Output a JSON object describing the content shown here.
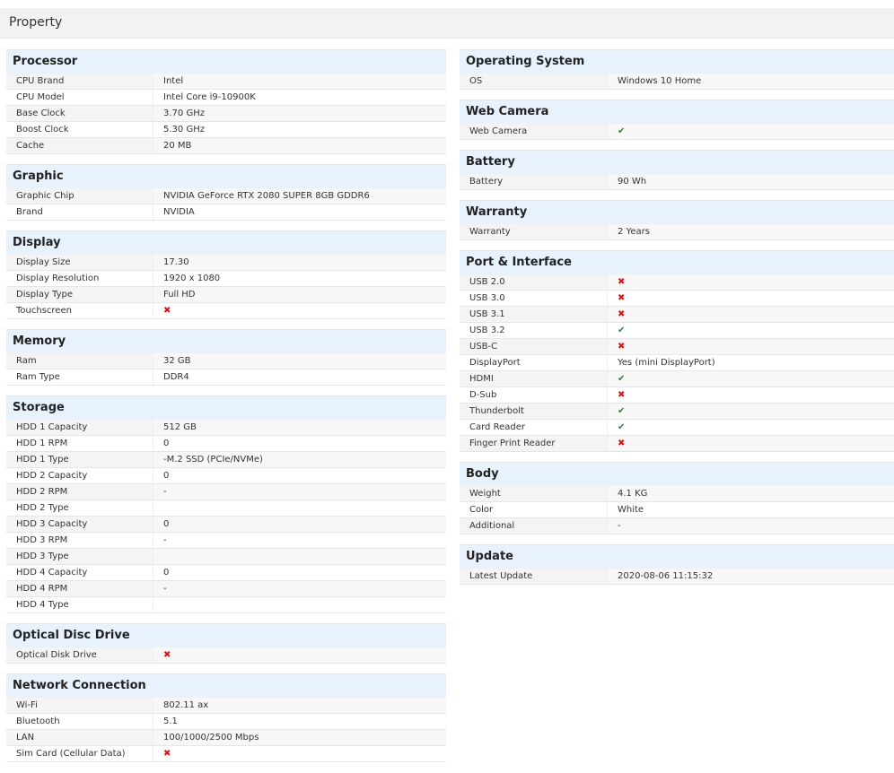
{
  "page_title": "Property",
  "colors": {
    "check": "#2e8a2e",
    "cross": "#d0191b",
    "section_bg": "#e8f2fd"
  },
  "left": [
    {
      "title": "Processor",
      "rows": [
        {
          "k": "CPU Brand",
          "v": "Intel"
        },
        {
          "k": "CPU Model",
          "v": "Intel Core i9-10900K"
        },
        {
          "k": "Base Clock",
          "v": "3.70 GHz"
        },
        {
          "k": "Boost Clock",
          "v": "5.30 GHz"
        },
        {
          "k": "Cache",
          "v": "20 MB"
        }
      ]
    },
    {
      "title": "Graphic",
      "rows": [
        {
          "k": "Graphic Chip",
          "v": "NVIDIA GeForce RTX 2080 SUPER 8GB GDDR6"
        },
        {
          "k": "Brand",
          "v": "NVIDIA"
        }
      ]
    },
    {
      "title": "Display",
      "rows": [
        {
          "k": "Display Size",
          "v": "17.30"
        },
        {
          "k": "Display Resolution",
          "v": "1920 x 1080"
        },
        {
          "k": "Display Type",
          "v": "Full HD"
        },
        {
          "k": "Touchscreen",
          "v": "",
          "icon": "cross-icon"
        }
      ]
    },
    {
      "title": "Memory",
      "rows": [
        {
          "k": "Ram",
          "v": "32 GB"
        },
        {
          "k": "Ram Type",
          "v": "DDR4"
        }
      ]
    },
    {
      "title": "Storage",
      "rows": [
        {
          "k": "HDD 1 Capacity",
          "v": "512 GB"
        },
        {
          "k": "HDD 1 RPM",
          "v": "0"
        },
        {
          "k": "HDD 1 Type",
          "v": "-M.2 SSD (PCIe/NVMe)"
        },
        {
          "k": "HDD 2 Capacity",
          "v": "0"
        },
        {
          "k": "HDD 2 RPM",
          "v": "-"
        },
        {
          "k": "HDD 2 Type",
          "v": ""
        },
        {
          "k": "HDD 3 Capacity",
          "v": "0"
        },
        {
          "k": "HDD 3 RPM",
          "v": "-"
        },
        {
          "k": "HDD 3 Type",
          "v": ""
        },
        {
          "k": "HDD 4 Capacity",
          "v": "0"
        },
        {
          "k": "HDD 4 RPM",
          "v": "-"
        },
        {
          "k": "HDD 4 Type",
          "v": ""
        }
      ]
    },
    {
      "title": "Optical Disc Drive",
      "rows": [
        {
          "k": "Optical Disk Drive",
          "v": "",
          "icon": "cross-icon"
        }
      ]
    },
    {
      "title": "Network Connection",
      "rows": [
        {
          "k": "Wi-Fi",
          "v": "802.11 ax"
        },
        {
          "k": "Bluetooth",
          "v": "5.1"
        },
        {
          "k": "LAN",
          "v": "100/1000/2500 Mbps"
        },
        {
          "k": "Sim Card (Cellular Data)",
          "v": "",
          "icon": "cross-icon"
        }
      ]
    }
  ],
  "right": [
    {
      "title": "Operating System",
      "rows": [
        {
          "k": "OS",
          "v": "Windows 10 Home"
        }
      ]
    },
    {
      "title": "Web Camera",
      "rows": [
        {
          "k": "Web Camera",
          "v": "",
          "icon": "check-icon"
        }
      ]
    },
    {
      "title": "Battery",
      "rows": [
        {
          "k": "Battery",
          "v": "90 Wh"
        }
      ]
    },
    {
      "title": "Warranty",
      "rows": [
        {
          "k": "Warranty",
          "v": "2 Years"
        }
      ]
    },
    {
      "title": "Port & Interface",
      "rows": [
        {
          "k": "USB 2.0",
          "v": "",
          "icon": "cross-icon"
        },
        {
          "k": "USB 3.0",
          "v": "",
          "icon": "cross-icon"
        },
        {
          "k": "USB 3.1",
          "v": "",
          "icon": "cross-icon"
        },
        {
          "k": "USB 3.2",
          "v": "",
          "icon": "check-icon"
        },
        {
          "k": "USB-C",
          "v": "",
          "icon": "cross-icon"
        },
        {
          "k": "DisplayPort",
          "v": "Yes (mini DisplayPort)"
        },
        {
          "k": "HDMI",
          "v": "",
          "icon": "check-icon"
        },
        {
          "k": "D-Sub",
          "v": "",
          "icon": "cross-icon"
        },
        {
          "k": "Thunderbolt",
          "v": "",
          "icon": "check-icon"
        },
        {
          "k": "Card Reader",
          "v": "",
          "icon": "check-icon"
        },
        {
          "k": "Finger Print Reader",
          "v": "",
          "icon": "cross-icon"
        }
      ]
    },
    {
      "title": "Body",
      "rows": [
        {
          "k": "Weight",
          "v": "4.1 KG"
        },
        {
          "k": "Color",
          "v": "White"
        },
        {
          "k": "Additional",
          "v": "-"
        }
      ]
    },
    {
      "title": "Update",
      "rows": [
        {
          "k": "Latest Update",
          "v": "2020-08-06 11:15:32"
        }
      ]
    }
  ]
}
